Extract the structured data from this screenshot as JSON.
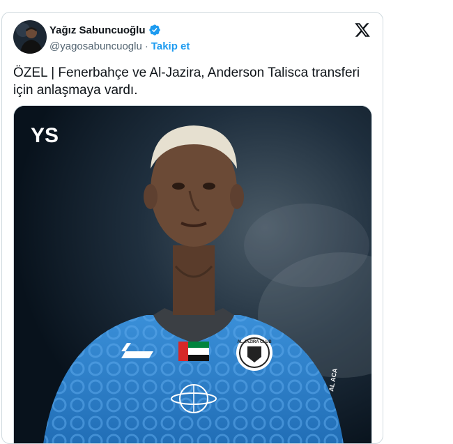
{
  "author": {
    "name": "Yağız Sabuncuoğlu",
    "handle": "@yagosabuncuoglu",
    "separator": "·",
    "follow_label": "Takip et",
    "verified": true,
    "avatar_icon": "profile-photo"
  },
  "platform": {
    "logo_icon": "x-logo"
  },
  "tweet": {
    "text": "ÖZEL | Fenerbahçe ve Al-Jazira, Anderson Talisca transferi için anlaşmaya vardı."
  },
  "media": {
    "watermark": "YS",
    "club_crest_text": "AL JAZIRA CLUB",
    "sleeve_text": "AL ACA",
    "kit_color": "#2f7fc8",
    "accent": "#1d9bf0"
  }
}
